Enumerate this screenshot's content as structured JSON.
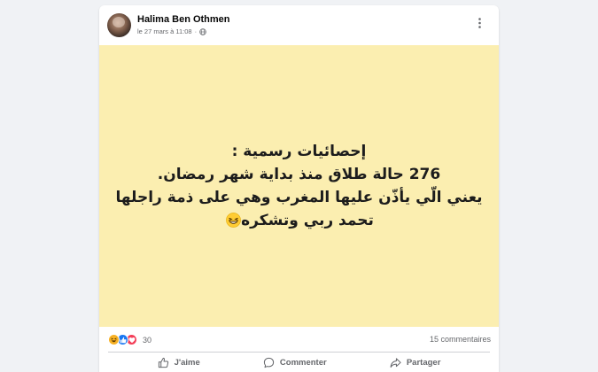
{
  "post": {
    "author": "Halima Ben Othmen",
    "timestamp": "le 27 mars à 11:08",
    "separator": "·",
    "privacy_icon": "globe-icon",
    "menu_icon": "more-options-icon",
    "background_color": "#fbeeb0",
    "text_lines": [
      "إحصائيات رسمية :",
      "276 حالة طلاق منذ بداية شهر رمضان.",
      "يعني الّي يأذّن عليها المغرب وهي على ذمة راجلها",
      "تحمد ربي وتشكره"
    ],
    "text_emoji": "grinning-squinting-face"
  },
  "stats": {
    "reactions": [
      "haha",
      "like",
      "love"
    ],
    "reaction_count": "30",
    "comments_label": "15 commentaires"
  },
  "actions": {
    "like_label": "J'aime",
    "comment_label": "Commenter",
    "share_label": "Partager"
  },
  "colors": {
    "like_blue": "#1877f2",
    "love_red": "#f33e58",
    "haha_yellow": "#f7b125",
    "secondary_text": "#65676b"
  }
}
